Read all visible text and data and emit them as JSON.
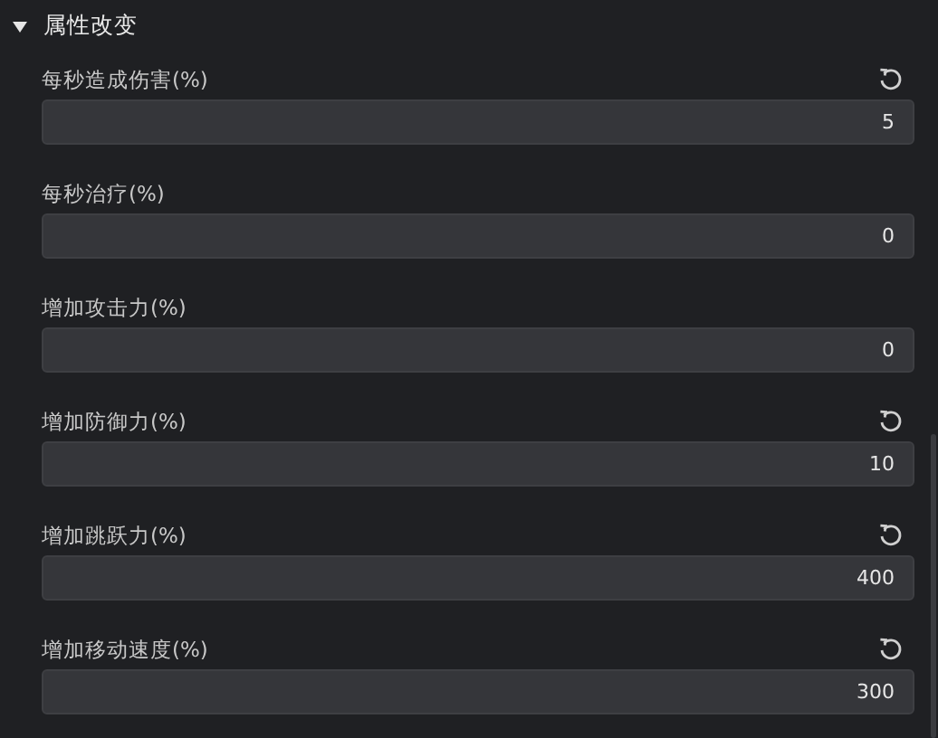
{
  "section": {
    "title": "属性改变",
    "expanded": true
  },
  "fields": [
    {
      "label": "每秒造成伤害(%)",
      "value": "5",
      "resettable": true
    },
    {
      "label": "每秒治疗(%)",
      "value": "0",
      "resettable": false
    },
    {
      "label": "增加攻击力(%)",
      "value": "0",
      "resettable": false
    },
    {
      "label": "增加防御力(%)",
      "value": "10",
      "resettable": true
    },
    {
      "label": "增加跳跃力(%)",
      "value": "400",
      "resettable": true
    },
    {
      "label": "增加移动速度(%)",
      "value": "300",
      "resettable": true
    }
  ]
}
